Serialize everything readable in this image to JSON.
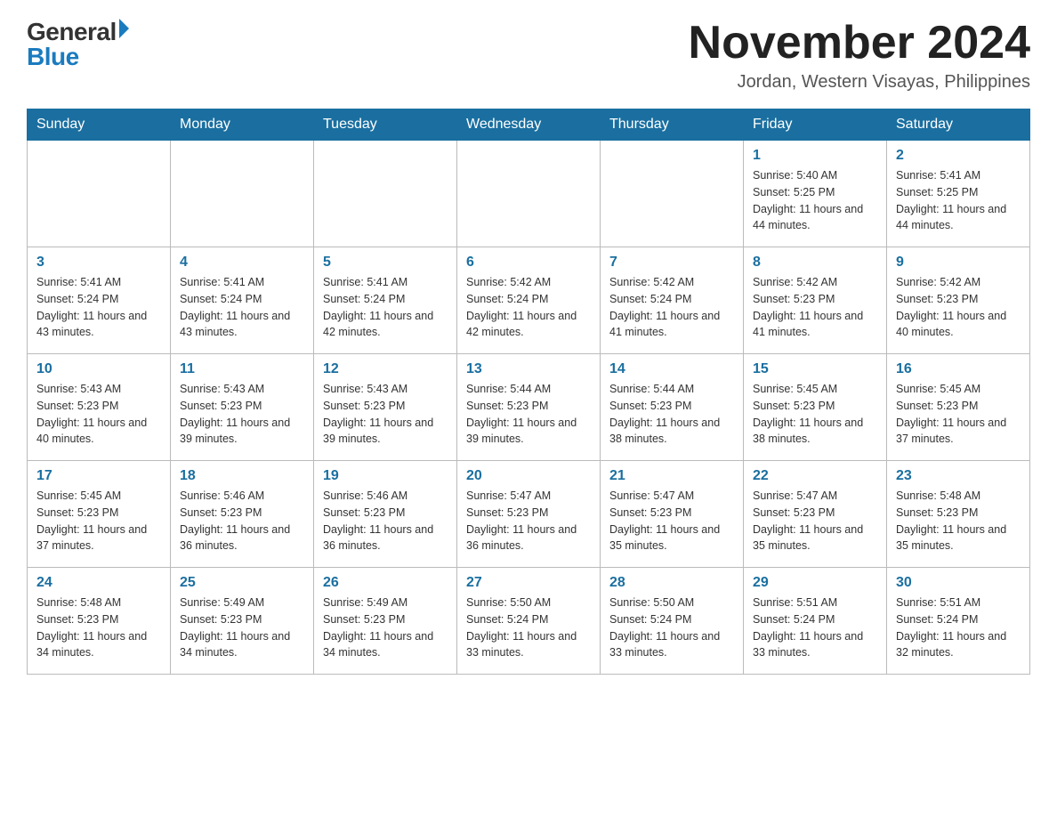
{
  "logo": {
    "general": "General",
    "blue": "Blue"
  },
  "title": "November 2024",
  "subtitle": "Jordan, Western Visayas, Philippines",
  "days_of_week": [
    "Sunday",
    "Monday",
    "Tuesday",
    "Wednesday",
    "Thursday",
    "Friday",
    "Saturday"
  ],
  "weeks": [
    [
      {
        "day": "",
        "info": ""
      },
      {
        "day": "",
        "info": ""
      },
      {
        "day": "",
        "info": ""
      },
      {
        "day": "",
        "info": ""
      },
      {
        "day": "",
        "info": ""
      },
      {
        "day": "1",
        "info": "Sunrise: 5:40 AM\nSunset: 5:25 PM\nDaylight: 11 hours and 44 minutes."
      },
      {
        "day": "2",
        "info": "Sunrise: 5:41 AM\nSunset: 5:25 PM\nDaylight: 11 hours and 44 minutes."
      }
    ],
    [
      {
        "day": "3",
        "info": "Sunrise: 5:41 AM\nSunset: 5:24 PM\nDaylight: 11 hours and 43 minutes."
      },
      {
        "day": "4",
        "info": "Sunrise: 5:41 AM\nSunset: 5:24 PM\nDaylight: 11 hours and 43 minutes."
      },
      {
        "day": "5",
        "info": "Sunrise: 5:41 AM\nSunset: 5:24 PM\nDaylight: 11 hours and 42 minutes."
      },
      {
        "day": "6",
        "info": "Sunrise: 5:42 AM\nSunset: 5:24 PM\nDaylight: 11 hours and 42 minutes."
      },
      {
        "day": "7",
        "info": "Sunrise: 5:42 AM\nSunset: 5:24 PM\nDaylight: 11 hours and 41 minutes."
      },
      {
        "day": "8",
        "info": "Sunrise: 5:42 AM\nSunset: 5:23 PM\nDaylight: 11 hours and 41 minutes."
      },
      {
        "day": "9",
        "info": "Sunrise: 5:42 AM\nSunset: 5:23 PM\nDaylight: 11 hours and 40 minutes."
      }
    ],
    [
      {
        "day": "10",
        "info": "Sunrise: 5:43 AM\nSunset: 5:23 PM\nDaylight: 11 hours and 40 minutes."
      },
      {
        "day": "11",
        "info": "Sunrise: 5:43 AM\nSunset: 5:23 PM\nDaylight: 11 hours and 39 minutes."
      },
      {
        "day": "12",
        "info": "Sunrise: 5:43 AM\nSunset: 5:23 PM\nDaylight: 11 hours and 39 minutes."
      },
      {
        "day": "13",
        "info": "Sunrise: 5:44 AM\nSunset: 5:23 PM\nDaylight: 11 hours and 39 minutes."
      },
      {
        "day": "14",
        "info": "Sunrise: 5:44 AM\nSunset: 5:23 PM\nDaylight: 11 hours and 38 minutes."
      },
      {
        "day": "15",
        "info": "Sunrise: 5:45 AM\nSunset: 5:23 PM\nDaylight: 11 hours and 38 minutes."
      },
      {
        "day": "16",
        "info": "Sunrise: 5:45 AM\nSunset: 5:23 PM\nDaylight: 11 hours and 37 minutes."
      }
    ],
    [
      {
        "day": "17",
        "info": "Sunrise: 5:45 AM\nSunset: 5:23 PM\nDaylight: 11 hours and 37 minutes."
      },
      {
        "day": "18",
        "info": "Sunrise: 5:46 AM\nSunset: 5:23 PM\nDaylight: 11 hours and 36 minutes."
      },
      {
        "day": "19",
        "info": "Sunrise: 5:46 AM\nSunset: 5:23 PM\nDaylight: 11 hours and 36 minutes."
      },
      {
        "day": "20",
        "info": "Sunrise: 5:47 AM\nSunset: 5:23 PM\nDaylight: 11 hours and 36 minutes."
      },
      {
        "day": "21",
        "info": "Sunrise: 5:47 AM\nSunset: 5:23 PM\nDaylight: 11 hours and 35 minutes."
      },
      {
        "day": "22",
        "info": "Sunrise: 5:47 AM\nSunset: 5:23 PM\nDaylight: 11 hours and 35 minutes."
      },
      {
        "day": "23",
        "info": "Sunrise: 5:48 AM\nSunset: 5:23 PM\nDaylight: 11 hours and 35 minutes."
      }
    ],
    [
      {
        "day": "24",
        "info": "Sunrise: 5:48 AM\nSunset: 5:23 PM\nDaylight: 11 hours and 34 minutes."
      },
      {
        "day": "25",
        "info": "Sunrise: 5:49 AM\nSunset: 5:23 PM\nDaylight: 11 hours and 34 minutes."
      },
      {
        "day": "26",
        "info": "Sunrise: 5:49 AM\nSunset: 5:23 PM\nDaylight: 11 hours and 34 minutes."
      },
      {
        "day": "27",
        "info": "Sunrise: 5:50 AM\nSunset: 5:24 PM\nDaylight: 11 hours and 33 minutes."
      },
      {
        "day": "28",
        "info": "Sunrise: 5:50 AM\nSunset: 5:24 PM\nDaylight: 11 hours and 33 minutes."
      },
      {
        "day": "29",
        "info": "Sunrise: 5:51 AM\nSunset: 5:24 PM\nDaylight: 11 hours and 33 minutes."
      },
      {
        "day": "30",
        "info": "Sunrise: 5:51 AM\nSunset: 5:24 PM\nDaylight: 11 hours and 32 minutes."
      }
    ]
  ]
}
